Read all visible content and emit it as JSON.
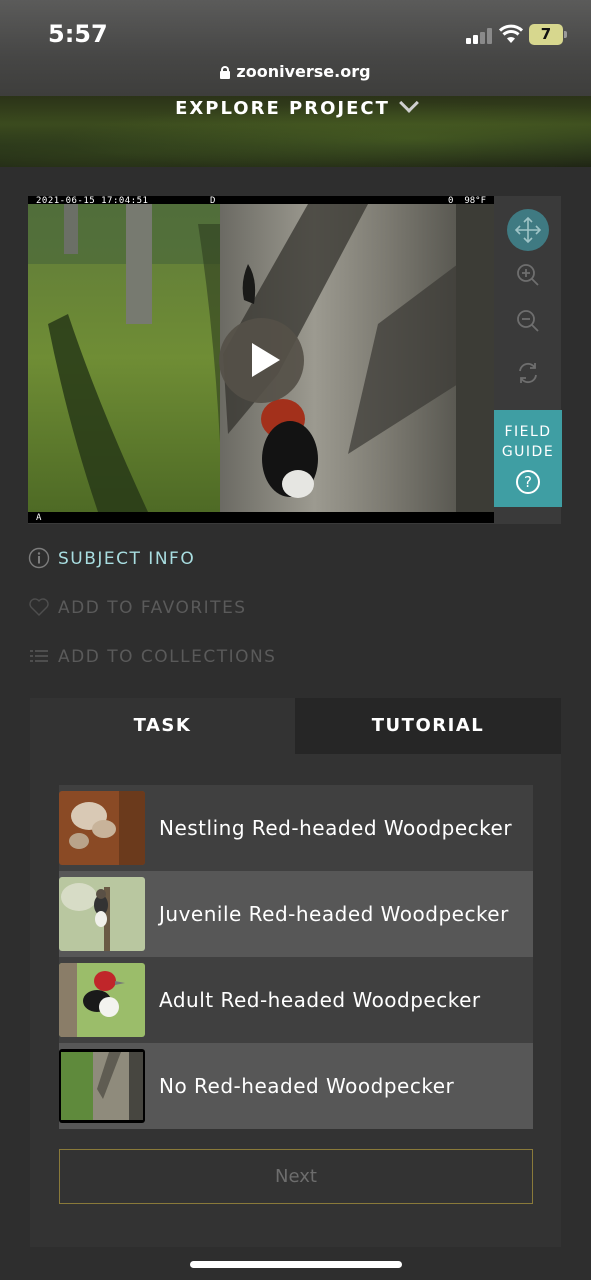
{
  "status_bar": {
    "time": "5:57",
    "battery": "7",
    "url": "zooniverse.org"
  },
  "header": {
    "explore_label": "EXPLORE PROJECT"
  },
  "subject": {
    "timestamp": "2021-06-15 17:04:51",
    "stamp_d": "D",
    "temperature": "98°F",
    "stamp_a": "A",
    "camera_indicator": "0"
  },
  "field_guide": {
    "label": "FIELD\nGUIDE",
    "help_glyph": "?"
  },
  "meta_links": {
    "subject_info": "SUBJECT INFO",
    "add_to_favorites": "ADD TO FAVORITES",
    "add_to_collections": "ADD TO COLLECTIONS"
  },
  "tabs": {
    "task": "TASK",
    "tutorial": "TUTORIAL"
  },
  "answers": [
    {
      "label": "Nestling Red-headed Woodpecker",
      "thumb": "nestling-photo"
    },
    {
      "label": "Juvenile Red-headed Woodpecker",
      "thumb": "juvenile-photo"
    },
    {
      "label": "Adult Red-headed Woodpecker",
      "thumb": "adult-photo"
    },
    {
      "label": "No Red-headed Woodpecker",
      "thumb": "empty-tree-photo"
    }
  ],
  "next_label": "Next",
  "colors": {
    "accent_teal": "#3f9ea3",
    "subject_info_text": "#a8dde0",
    "disabled_text": "#5a5a5a",
    "next_border": "#8a7a3a"
  }
}
